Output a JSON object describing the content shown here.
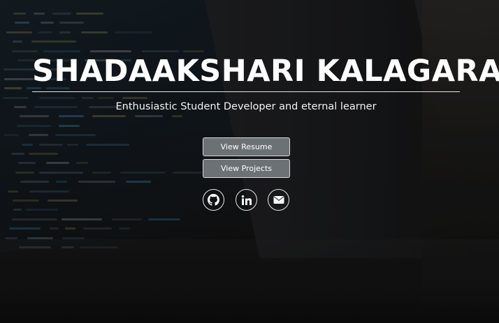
{
  "hero": {
    "name": "SHADAAKSHARI KALAGARA",
    "tagline": "Enthusiastic Student Developer and eternal learner"
  },
  "buttons": {
    "resume_label": "View Resume",
    "projects_label": "View Projects"
  },
  "social": [
    {
      "icon": "github-icon"
    },
    {
      "icon": "linkedin-icon"
    },
    {
      "icon": "email-icon"
    }
  ],
  "colors": {
    "button_bg": "#6c7176",
    "text": "#ffffff",
    "code_blue": "#4aa3d8",
    "code_yellow": "#c9b85a"
  }
}
